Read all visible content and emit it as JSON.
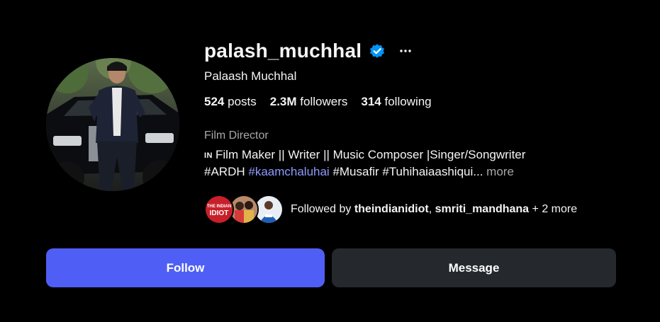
{
  "profile": {
    "username": "palash_muchhal",
    "full_name": "Palaash Muchhal",
    "category": "Film Director",
    "verified": true
  },
  "stats": {
    "posts_count": "524",
    "posts_label": "posts",
    "followers_count": "2.3M",
    "followers_label": "followers",
    "following_count": "314",
    "following_label": "following"
  },
  "bio": {
    "line1_prefix": "IN",
    "line1": "Film Maker || Writer || Music Composer |Singer/Songwriter",
    "line2_part1": "#ARDH ",
    "line2_link": "#kaamchaluhai",
    "line2_part2": " #Musafir #Tuhihaiaashiqui...",
    "more_label": " more"
  },
  "followed_by": {
    "prefix": "Followed by ",
    "user1": "theindianidiot",
    "separator": ", ",
    "user2": "smriti_mandhana",
    "suffix": " + 2 more",
    "avatar1_text_top": "THE INDIAN",
    "avatar1_text_bottom": "IDIOT"
  },
  "actions": {
    "follow_label": "Follow",
    "message_label": "Message"
  },
  "icons": {
    "verified": "verified-badge-icon",
    "more": "more-options-icon"
  },
  "colors": {
    "background": "#000000",
    "text": "#f5f5f5",
    "secondary_text": "#a8a8a8",
    "link": "#8e9bff",
    "follow_button": "#4f5ff5",
    "message_button": "#25292e",
    "verified": "#0095f6"
  }
}
